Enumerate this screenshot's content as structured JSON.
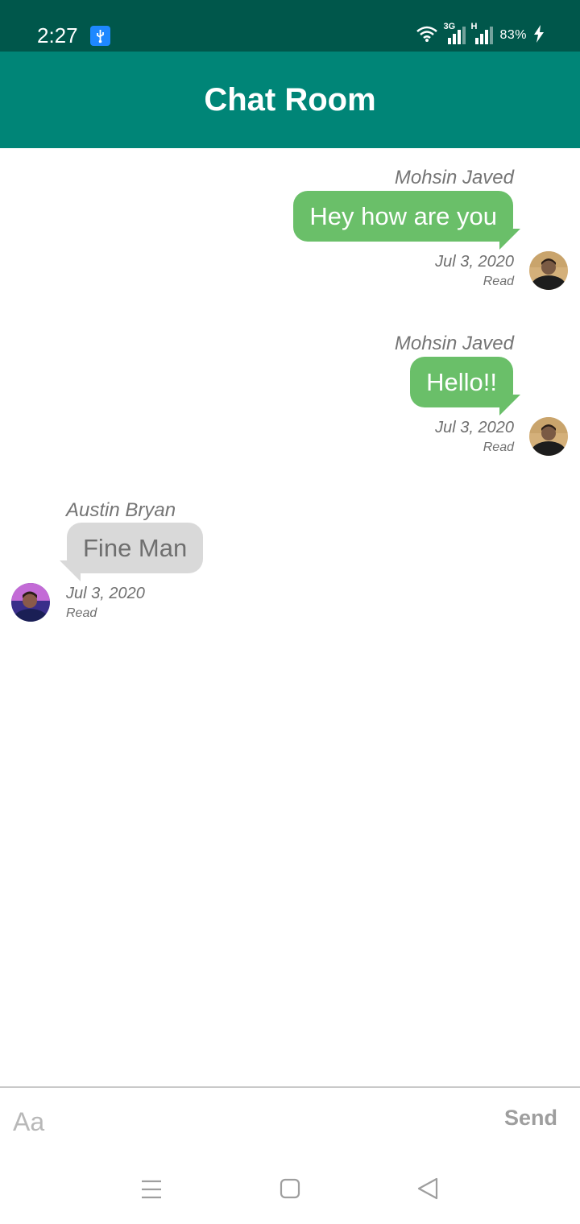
{
  "status_bar": {
    "time": "2:27",
    "network_1": "3G",
    "network_2": "H",
    "battery": "83%"
  },
  "app_bar": {
    "title": "Chat Room"
  },
  "messages": [
    {
      "sender": "Mohsin Javed",
      "text": "Hey how are you",
      "date": "Jul 3, 2020",
      "status": "Read",
      "direction": "outgoing"
    },
    {
      "sender": "Mohsin Javed",
      "text": "Hello!!",
      "date": "Jul 3, 2020",
      "status": "Read",
      "direction": "outgoing"
    },
    {
      "sender": "Austin Bryan",
      "text": "Fine Man",
      "date": "Jul 3, 2020",
      "status": "Read",
      "direction": "incoming"
    }
  ],
  "composer": {
    "placeholder": "Aa",
    "send_label": "Send"
  },
  "colors": {
    "status_bar": "#00574b",
    "app_bar": "#008577",
    "outgoing_bubble": "#6abf69",
    "incoming_bubble": "#d9d9d9"
  },
  "icons": {
    "usb": "usb-icon",
    "wifi": "wifi-icon",
    "signal": "signal-icon",
    "charging": "charging-icon",
    "nav_menu": "menu-icon",
    "nav_home": "home-icon",
    "nav_back": "back-icon"
  }
}
